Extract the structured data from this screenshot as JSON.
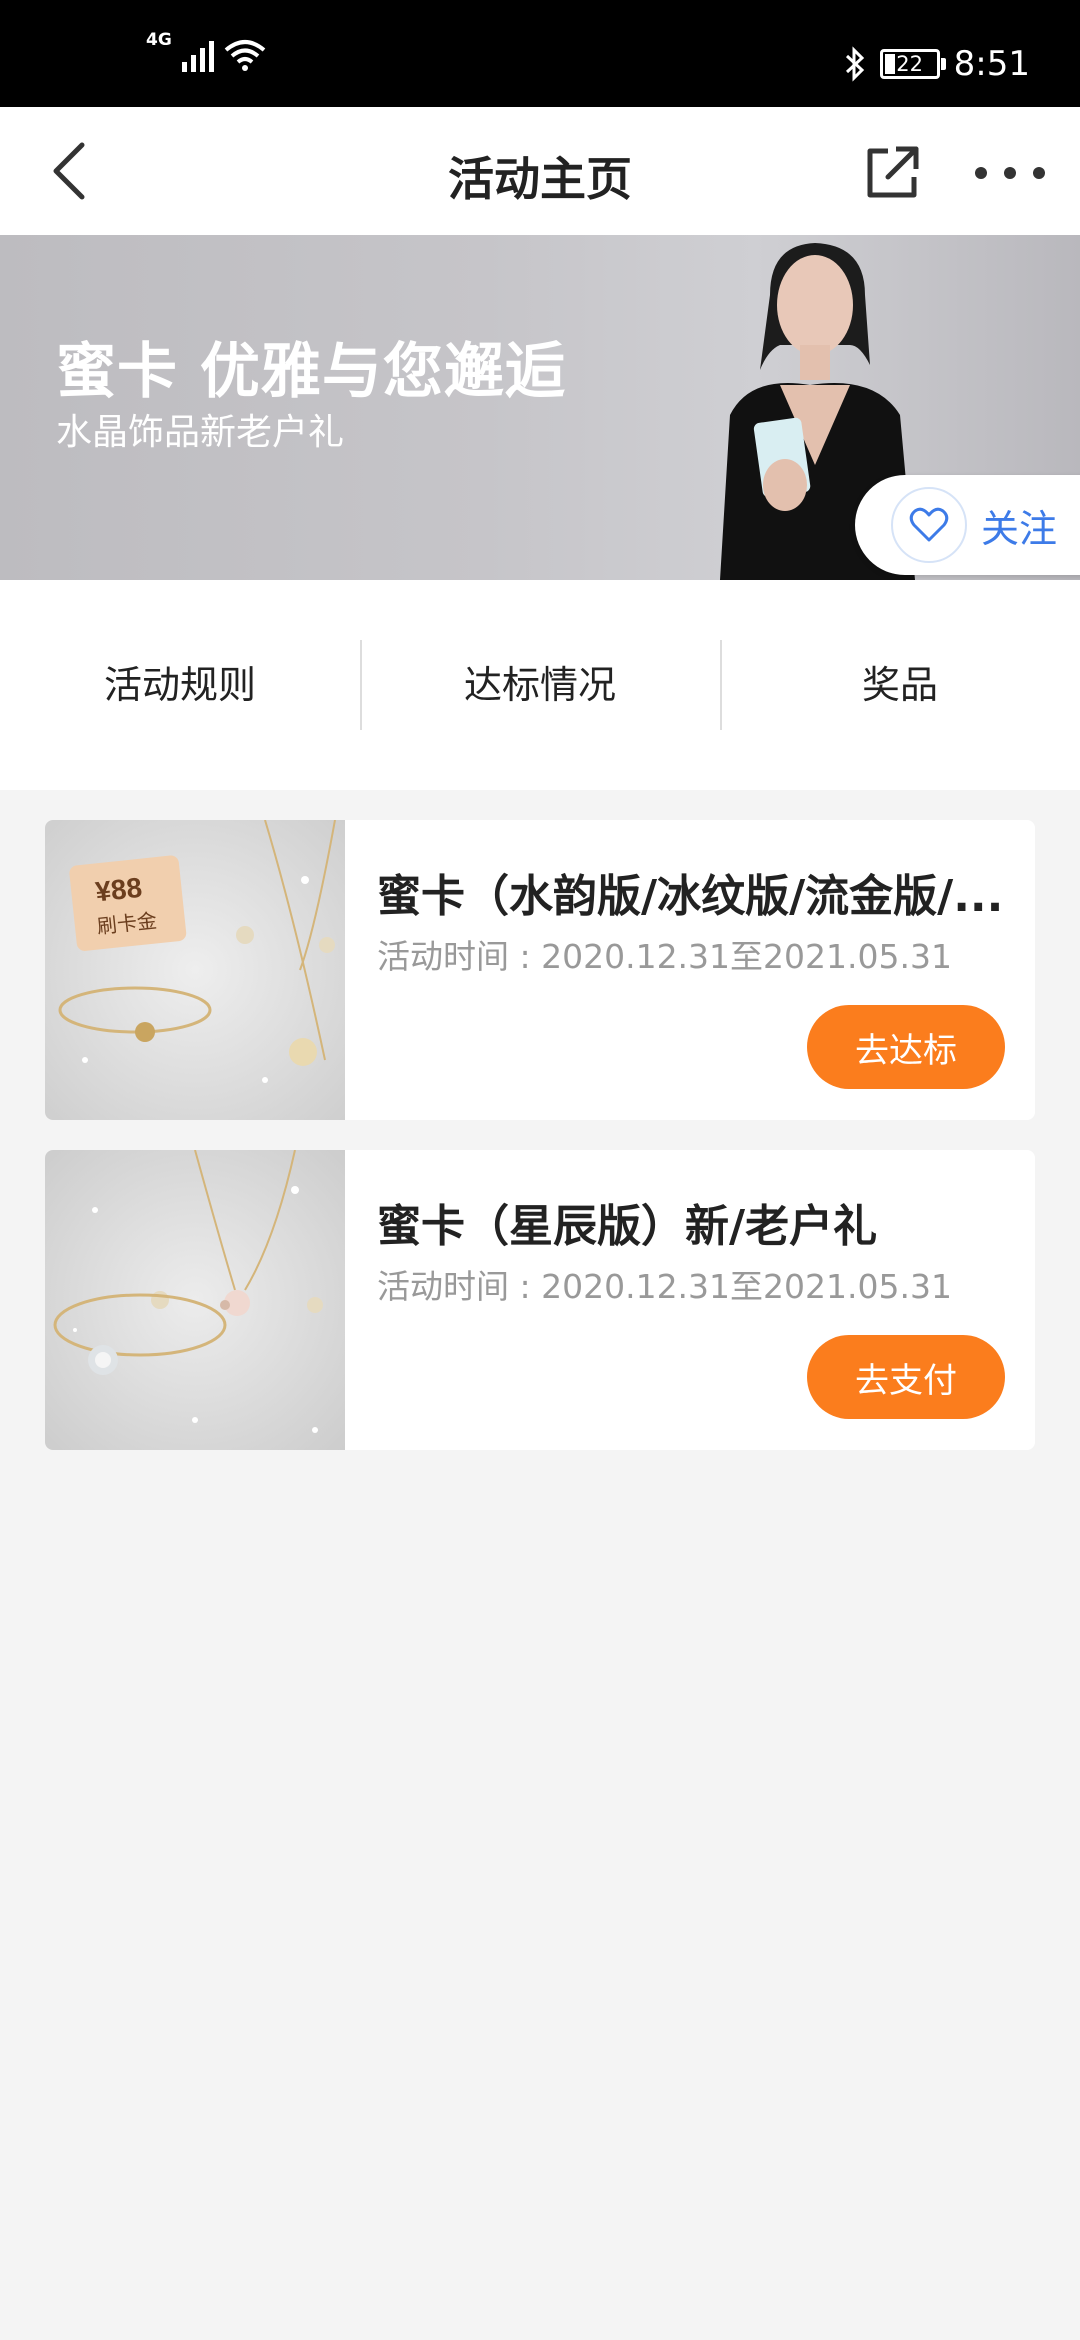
{
  "status_bar": {
    "network": "4G",
    "battery": "22",
    "time": "8:51"
  },
  "nav": {
    "title": "活动主页"
  },
  "banner": {
    "title": "蜜卡 优雅与您邂逅",
    "subtitle": "水晶饰品新老户礼",
    "follow_label": "关注"
  },
  "tabs": [
    {
      "label": "活动规则"
    },
    {
      "label": "达标情况"
    },
    {
      "label": "奖品"
    }
  ],
  "activities": [
    {
      "title": "蜜卡（水韵版/冰纹版/流金版/...",
      "time": "活动时间 : 2020.12.31至2021.05.31",
      "button": "去达标",
      "image_tag_price": "¥88",
      "image_tag_label": "刷卡金"
    },
    {
      "title": "蜜卡（星辰版）新/老户礼",
      "time": "活动时间 : 2020.12.31至2021.05.31",
      "button": "去支付"
    }
  ],
  "colors": {
    "accent": "#fb7d1d",
    "follow": "#3d7be8"
  }
}
